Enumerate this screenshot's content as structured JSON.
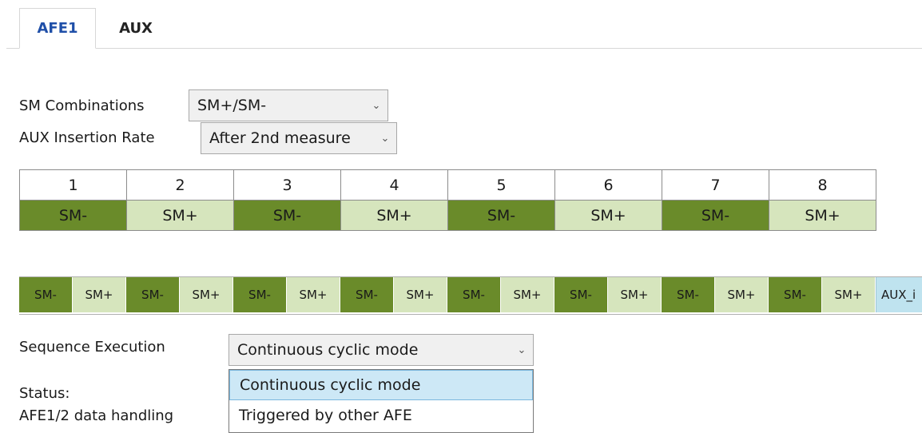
{
  "tabs": [
    {
      "label": "AFE1",
      "active": true
    },
    {
      "label": "AUX",
      "active": false
    }
  ],
  "sm_combinations": {
    "label": "SM Combinations",
    "value": "SM+/SM-"
  },
  "aux_insertion_rate": {
    "label": "AUX Insertion Rate",
    "value": "After 2nd measure"
  },
  "table": {
    "headers": [
      "1",
      "2",
      "3",
      "4",
      "5",
      "6",
      "7",
      "8"
    ],
    "cells": [
      "SM-",
      "SM+",
      "SM-",
      "SM+",
      "SM-",
      "SM+",
      "SM-",
      "SM+"
    ]
  },
  "sequence": [
    "SM-",
    "SM+",
    "SM-",
    "SM+",
    "SM-",
    "SM+",
    "SM-",
    "SM+",
    "SM-",
    "SM+",
    "SM-",
    "SM+",
    "SM-",
    "SM+",
    "SM-",
    "SM+",
    "AUX_i"
  ],
  "sequence_execution": {
    "label": "Sequence Execution",
    "value": "Continuous cyclic mode",
    "options": [
      "Continuous cyclic mode",
      "Triggered by other AFE"
    ]
  },
  "status_label": "Status:",
  "data_handling_label": "AFE1/2 data handling",
  "colors": {
    "dark_green": "#6a8b2a",
    "light_green": "#d6e5bd",
    "aux_blue": "#bfe3ef",
    "tab_blue": "#1f4fa8"
  },
  "icons": {
    "dropdown": "chevron-down-icon"
  }
}
